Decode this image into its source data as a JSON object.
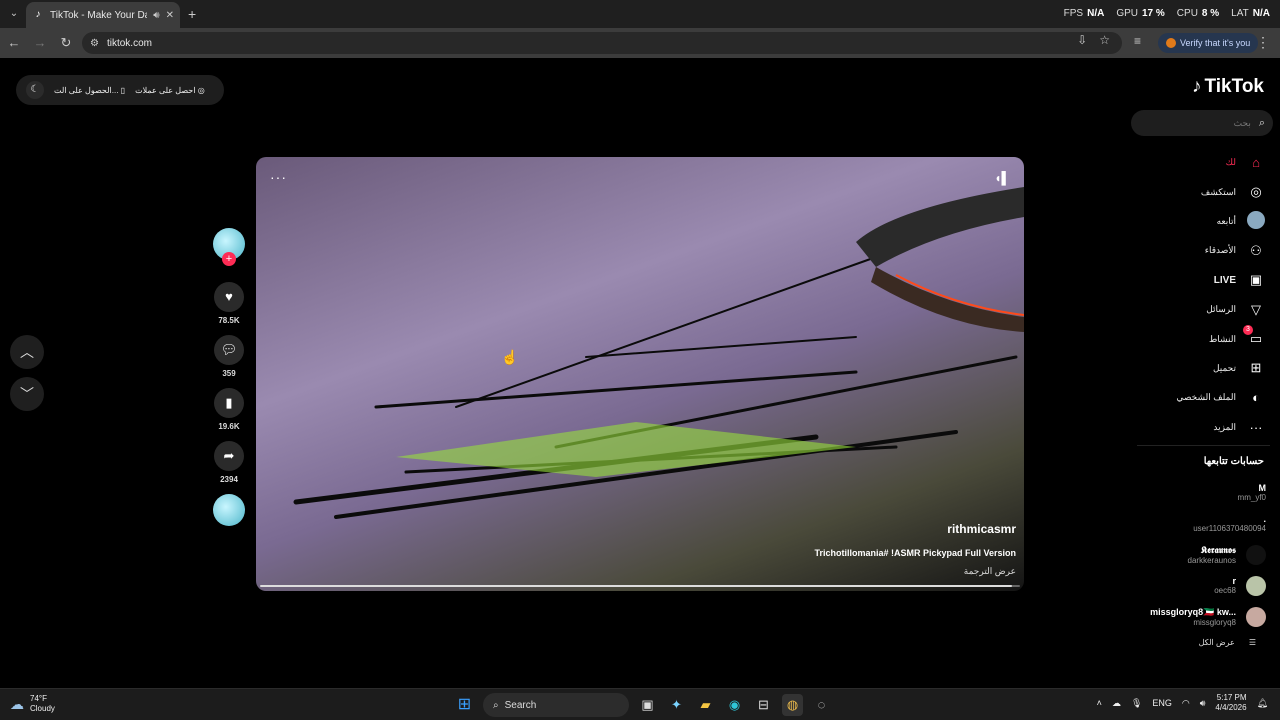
{
  "browser": {
    "tab_title": "TikTok - Make Your Day",
    "url": "tiktok.com",
    "verify_label": "Verify that it's you",
    "hud": [
      {
        "label": "FPS",
        "value": "N/A"
      },
      {
        "label": "GPU",
        "value": "17 %"
      },
      {
        "label": "CPU",
        "value": "8 %"
      },
      {
        "label": "LAT",
        "value": "N/A"
      }
    ]
  },
  "topbar": {
    "get_coins": "احصل على عملات",
    "get_app": "الحصول على الت..."
  },
  "brand": {
    "logo": "TikTok",
    "accent": "#fe2c55"
  },
  "search": {
    "placeholder": "بحث"
  },
  "menu": [
    {
      "label": "لك",
      "icon": "home-icon"
    },
    {
      "label": "استكشف",
      "icon": "compass-icon"
    },
    {
      "label": "أتابعه",
      "icon": "following-avatar-icon"
    },
    {
      "label": "الأصدقاء",
      "icon": "friends-icon"
    },
    {
      "label": "LIVE",
      "icon": "live-icon"
    },
    {
      "label": "الرسائل",
      "icon": "send-icon"
    },
    {
      "label": "النشاط",
      "icon": "activity-icon",
      "badge": "3"
    },
    {
      "label": "تحميل",
      "icon": "upload-icon"
    },
    {
      "label": "الملف الشخصي",
      "icon": "profile-icon"
    },
    {
      "label": "المزيد",
      "icon": "more-icon"
    }
  ],
  "following": {
    "title": "حسابات تتابعها",
    "accounts": [
      {
        "name": "M",
        "handle": "mm_yf0"
      },
      {
        "name": ".",
        "handle": "user1106370480094"
      },
      {
        "name": "𝕶𝖊𝖗𝖆𝖚𝖓𝖔𝖘",
        "handle": "darkkeraunos"
      },
      {
        "name": "r",
        "handle": "oec68"
      },
      {
        "name": "missgloryq8🇰🇼 kw...",
        "handle": "missgloryq8"
      }
    ],
    "see_all": "عرض الكل"
  },
  "video": {
    "author": "rithmicasmr",
    "description": "Trichotillomania# !ASMR Pickypad Full Version",
    "translate": "عرض الترجمة",
    "progress": 0.99
  },
  "actions": {
    "likes": "78.5K",
    "comments": "359",
    "saves": "19.6K",
    "shares": "2394"
  },
  "taskbar": {
    "temp": "74°F",
    "condition": "Cloudy",
    "search_label": "Search",
    "lang": "ENG",
    "time": "5:17 PM",
    "date": "4/4/2026"
  }
}
